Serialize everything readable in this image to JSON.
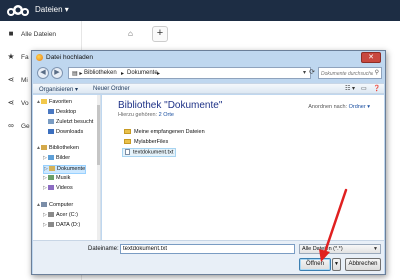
{
  "app": {
    "title": "Dateien ▾"
  },
  "sidebar": {
    "items": [
      {
        "label": "Alle Dateien",
        "icon": "folder-icon"
      },
      {
        "label": "Fa",
        "icon": "star-icon"
      },
      {
        "label": "Mi",
        "icon": "share-icon"
      },
      {
        "label": "Vo",
        "icon": "share-icon"
      },
      {
        "label": "Ge",
        "icon": "link-icon"
      }
    ]
  },
  "toolbar": {
    "add_label": "+"
  },
  "dialog": {
    "title": "Datei hochladen",
    "close_label": "✕",
    "breadcrumb": [
      "Bibliotheken",
      "Dokumente"
    ],
    "search_placeholder": "Dokumente durchsuchen",
    "commands": {
      "organize": "Organisieren ▾",
      "new_folder": "Neuer Ordner"
    },
    "nav_tree": [
      {
        "label": "Favoriten",
        "level": 0,
        "expand": "▲",
        "color": "#f2c84b"
      },
      {
        "label": "Desktop",
        "level": 1,
        "expand": "",
        "color": "#4a78c2"
      },
      {
        "label": "Zuletzt besucht",
        "level": 1,
        "expand": "",
        "color": "#7a9cc3"
      },
      {
        "label": "Downloads",
        "level": 1,
        "expand": "",
        "color": "#3b6fbf"
      },
      {
        "label": "Bibliotheken",
        "level": 0,
        "expand": "▲",
        "color": "#d4a94a"
      },
      {
        "label": "Bilder",
        "level": 1,
        "expand": "▷",
        "color": "#5ea0d8"
      },
      {
        "label": "Dokumente",
        "level": 1,
        "expand": "▷",
        "color": "#d4b25a",
        "selected": true
      },
      {
        "label": "Musik",
        "level": 1,
        "expand": "▷",
        "color": "#6aa06a"
      },
      {
        "label": "Videos",
        "level": 1,
        "expand": "▷",
        "color": "#8c6cc2"
      },
      {
        "label": "Computer",
        "level": 0,
        "expand": "▲",
        "color": "#7b8ea8"
      },
      {
        "label": "Acer (C:)",
        "level": 1,
        "expand": "▷",
        "color": "#8a8a8a"
      },
      {
        "label": "DATA (D:)",
        "level": 1,
        "expand": "▷",
        "color": "#8a8a8a"
      }
    ],
    "library_title": "Bibliothek \"Dokumente\"",
    "library_sub_prefix": "Hierzu gehören:",
    "library_sub_link": "2 Orte",
    "arrange_label": "Anordnen nach:",
    "arrange_value": "Ordner ▾",
    "files": [
      {
        "name": "Meine empfangenen Dateien",
        "type": "folder"
      },
      {
        "name": "MylabberFiles",
        "type": "folder"
      },
      {
        "name": "textdokument.txt",
        "type": "document",
        "selected": true
      }
    ],
    "filename_label": "Dateiname:",
    "filename_value": "textdokument.txt",
    "filter_value": "Alle Dateien (*.*)",
    "open_button": "Öffnen",
    "cancel_button": "Abbrechen"
  },
  "colors": {
    "topbar": "#1d2d44",
    "dialog_frame": "#bfd7ef",
    "arrow": "#e02020"
  }
}
